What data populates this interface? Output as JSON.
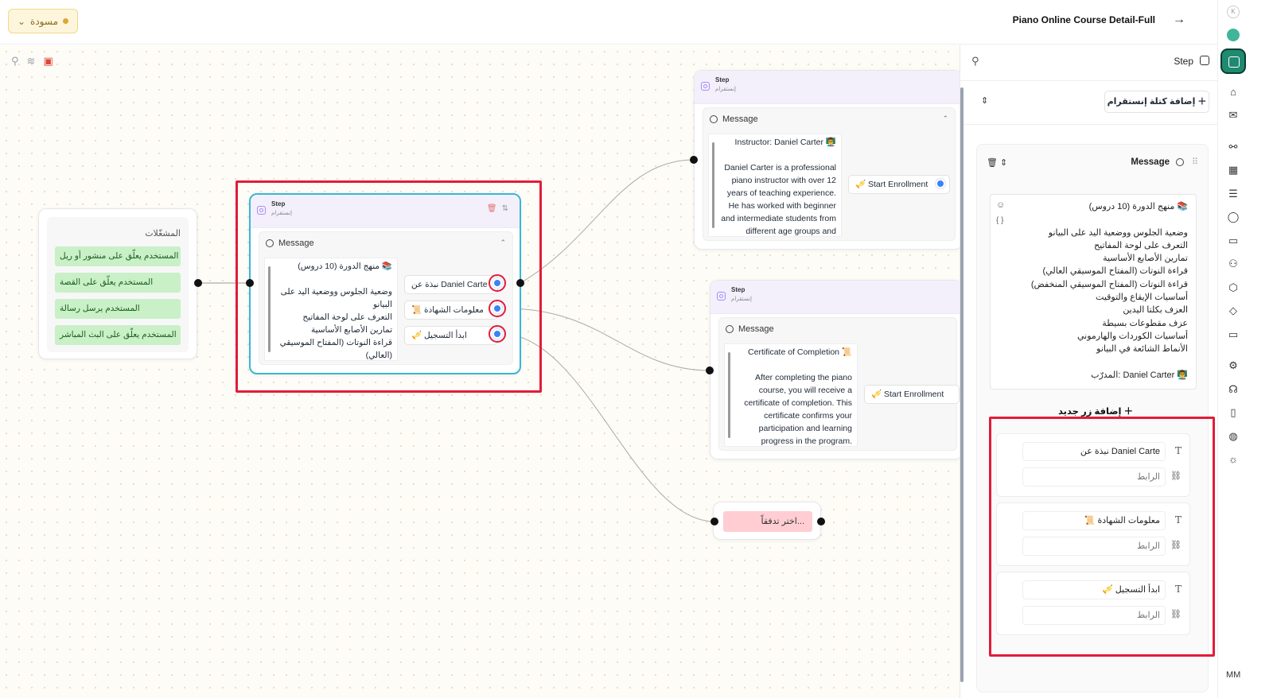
{
  "header": {
    "status_label": "مسودة",
    "flow_title": "Piano Online Course Detail-Full"
  },
  "triggers": {
    "title": "المشغّلات",
    "items": [
      "المستخدم يعلّق على منشور أو ريل",
      "المستخدم يعلّق على القصة",
      "المستخدم يرسل رسالة",
      "المستخدم يعلّق على البث المباشر"
    ]
  },
  "step_main": {
    "title": "Step",
    "subtitle": "إنستقرام",
    "message_label": "Message",
    "text": "منهج الدورة (10 دروس) 📚\n\nوضعية الجلوس ووضعية اليد على البيانو\nالتعرف على لوحة المفاتيح\nتمارين الأصابع الأساسية\nقراءة النوتات (المفتاح الموسيقي (العالي)",
    "buttons": [
      "نبذة عن Daniel Carte",
      "📜 معلومات الشهادة",
      "🎺 ابدأ التسجيل"
    ]
  },
  "step_instructor": {
    "title": "Step",
    "subtitle": "إنستقرام",
    "message_label": "Message",
    "text": "Instructor: Daniel Carter 👨‍🏫\n\nDaniel Carter is a professional piano instructor with over 12 years of teaching experience. He has worked with beginner and intermediate students from different age groups and",
    "button": "🎺 Start Enrollment"
  },
  "step_certificate": {
    "title": "Step",
    "subtitle": "إنستقرام",
    "message_label": "Message",
    "text": "Certificate of Completion 📜\n\nAfter completing the piano course, you will receive a certificate of completion. This certificate confirms your participation and learning progress in the program.",
    "button": "🎺 Start Enrollment"
  },
  "choose_flow": {
    "label": "اختر تدفقاً..."
  },
  "panel": {
    "header_title": "Step",
    "add_instagram_block": "إضافة كتلة إنستقرام",
    "message_title": "Message",
    "message_text": "منهج الدورة (10 دروس) 📚\n\nوضعية الجلوس ووضعية اليد على البيانو\nالتعرف على لوحة المفاتيح\nتمارين الأصابع الأساسية\nقراءة النوتات (المفتاح الموسيقي العالي)\nقراءة النوتات (المفتاح الموسيقي المنخفض)\nأساسيات الإيقاع والتوقيت\nالعزف بكلتا اليدين\nعزف مقطوعات بسيطة\nأساسيات الكوردات والهارموني\nالأنماط الشائعة في البيانو\n\nالمدرّب: Daniel Carter 👨‍🏫",
    "add_button_label": "إضافة زر جديد",
    "buttons": [
      {
        "label": "نبذة عن Daniel Carte",
        "url_placeholder": "الرابط"
      },
      {
        "label": "📜 معلومات الشهادة",
        "url_placeholder": "الرابط"
      },
      {
        "label": "🎺 ابدأ التسجيل",
        "url_placeholder": "الرابط"
      }
    ]
  },
  "rail": {
    "top_badge": "K",
    "user_initials": "MM",
    "icons": [
      "home-icon",
      "inbox-icon",
      "flows-icon",
      "layout-icon",
      "list-icon",
      "chat-icon",
      "comments-icon",
      "contacts-icon",
      "box-icon",
      "tag-icon",
      "card-icon",
      "settings-icon",
      "support-icon",
      "book-icon",
      "globe-icon",
      "theme-icon"
    ]
  },
  "colors": {
    "highlight": "#e21c3a",
    "trigger_green": "#c9f0c7",
    "handle_blue": "#3b82f6",
    "selected_node_border": "#38b6d8",
    "choose_flow_pink": "#ffcdd2",
    "rail_active": "#1f8a70"
  }
}
